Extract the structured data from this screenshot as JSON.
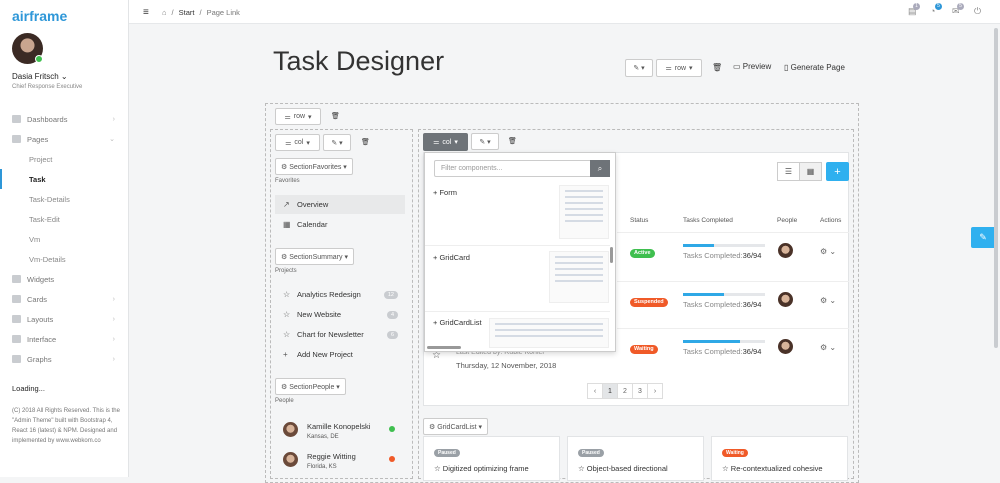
{
  "app": {
    "logo": "airframe"
  },
  "user": {
    "name": "Dasia Fritsch ⌄",
    "role": "Chief Response Executive"
  },
  "nav": [
    {
      "label": "Dashboards",
      "chev": "›"
    },
    {
      "label": "Pages",
      "chev": "⌄"
    }
  ],
  "nav_sub": [
    "Project",
    "Task",
    "Task-Details",
    "Task-Edit",
    "Vm",
    "Vm-Details"
  ],
  "nav2": [
    {
      "label": "Widgets",
      "chev": ""
    },
    {
      "label": "Cards",
      "chev": "›"
    },
    {
      "label": "Layouts",
      "chev": "›"
    },
    {
      "label": "Interface",
      "chev": "›"
    },
    {
      "label": "Graphs",
      "chev": "›"
    }
  ],
  "loading": "Loading...",
  "copyright": "(C) 2018 All Rights Reserved. This is the \"Admin Theme\" built with Bootstrap 4, React 16 (latest) & NPM. Designed and implemented by www.webkom.co",
  "breadcrumb": {
    "home": "⌂",
    "start": "Start",
    "link": "Page Link"
  },
  "topbar": {
    "badge1": "1",
    "badge2": "5",
    "badge3": "5"
  },
  "page": {
    "title": "Task Designer"
  },
  "toolbar": {
    "row": "row",
    "preview": "Preview",
    "generate": "Generate Page"
  },
  "grid": {
    "row": "row",
    "col": "col",
    "col_active": "col",
    "edit": "✎ ▾"
  },
  "left": {
    "favorites_btn": "⚙ SectionFavorites ▾",
    "favorites_label": "Favorites",
    "favorites": [
      {
        "icon": "↗",
        "label": "Overview"
      },
      {
        "icon": "▦",
        "label": "Calendar"
      }
    ],
    "summary_btn": "⚙ SectionSummary ▾",
    "projects_label": "Projects",
    "projects": [
      {
        "icon": "☆",
        "label": "Analytics Redesign",
        "count": "12"
      },
      {
        "icon": "☆",
        "label": "New Website",
        "count": "4"
      },
      {
        "icon": "☆",
        "label": "Chart for Newsletter",
        "count": "6"
      },
      {
        "icon": "+",
        "label": "Add New Project",
        "count": ""
      }
    ],
    "people_btn": "⚙ SectionPeople ▾",
    "people_label": "People",
    "people": [
      {
        "name": "Kamille Konopelski",
        "loc": "Kansas, DE",
        "status_color": "#3fbf4f"
      },
      {
        "name": "Reggie Witting",
        "loc": "Florida, KS",
        "status_color": "#f05a28"
      }
    ]
  },
  "dropdown": {
    "placeholder": "Filter components...",
    "items": [
      {
        "label": "Form"
      },
      {
        "label": "GridCard"
      },
      {
        "label": "GridCardList"
      }
    ]
  },
  "table": {
    "headers": {
      "status": "Status",
      "tasks": "Tasks Completed",
      "people": "People",
      "actions": "Actions"
    },
    "rows": [
      {
        "status": "Active",
        "status_color": "#3fbf4f",
        "progress": 0.38,
        "tc_label": "Tasks Completed:",
        "tc_value": "36/94"
      },
      {
        "status": "Suspended",
        "status_color": "#f05a28",
        "progress": 0.5,
        "tc_label": "Tasks Completed:",
        "tc_value": "36/94"
      },
      {
        "status": "Waiting",
        "status_color": "#f05a28",
        "progress": 0.7,
        "tc_label": "Tasks Completed:",
        "tc_value": "36/94"
      }
    ],
    "edited": "Last Edited by: Rubie Kohler",
    "edited_date": "Thursday, 12 November, 2018"
  },
  "pager": [
    "‹",
    "1",
    "2",
    "3",
    "›"
  ],
  "gridcardlist": {
    "btn": "⚙ GridCardList ▾",
    "cards": [
      {
        "badge": "Paused",
        "badge_color": "#9aa0a6",
        "title": "☆  Digitized optimizing frame"
      },
      {
        "badge": "Paused",
        "badge_color": "#9aa0a6",
        "title": "☆  Object-based directional"
      },
      {
        "badge": "Waiting",
        "badge_color": "#f05a28",
        "title": "☆  Re-contextualized cohesive"
      }
    ]
  },
  "icons": {
    "trash": "🗑",
    "menu": "≡",
    "pencil": "✎"
  }
}
